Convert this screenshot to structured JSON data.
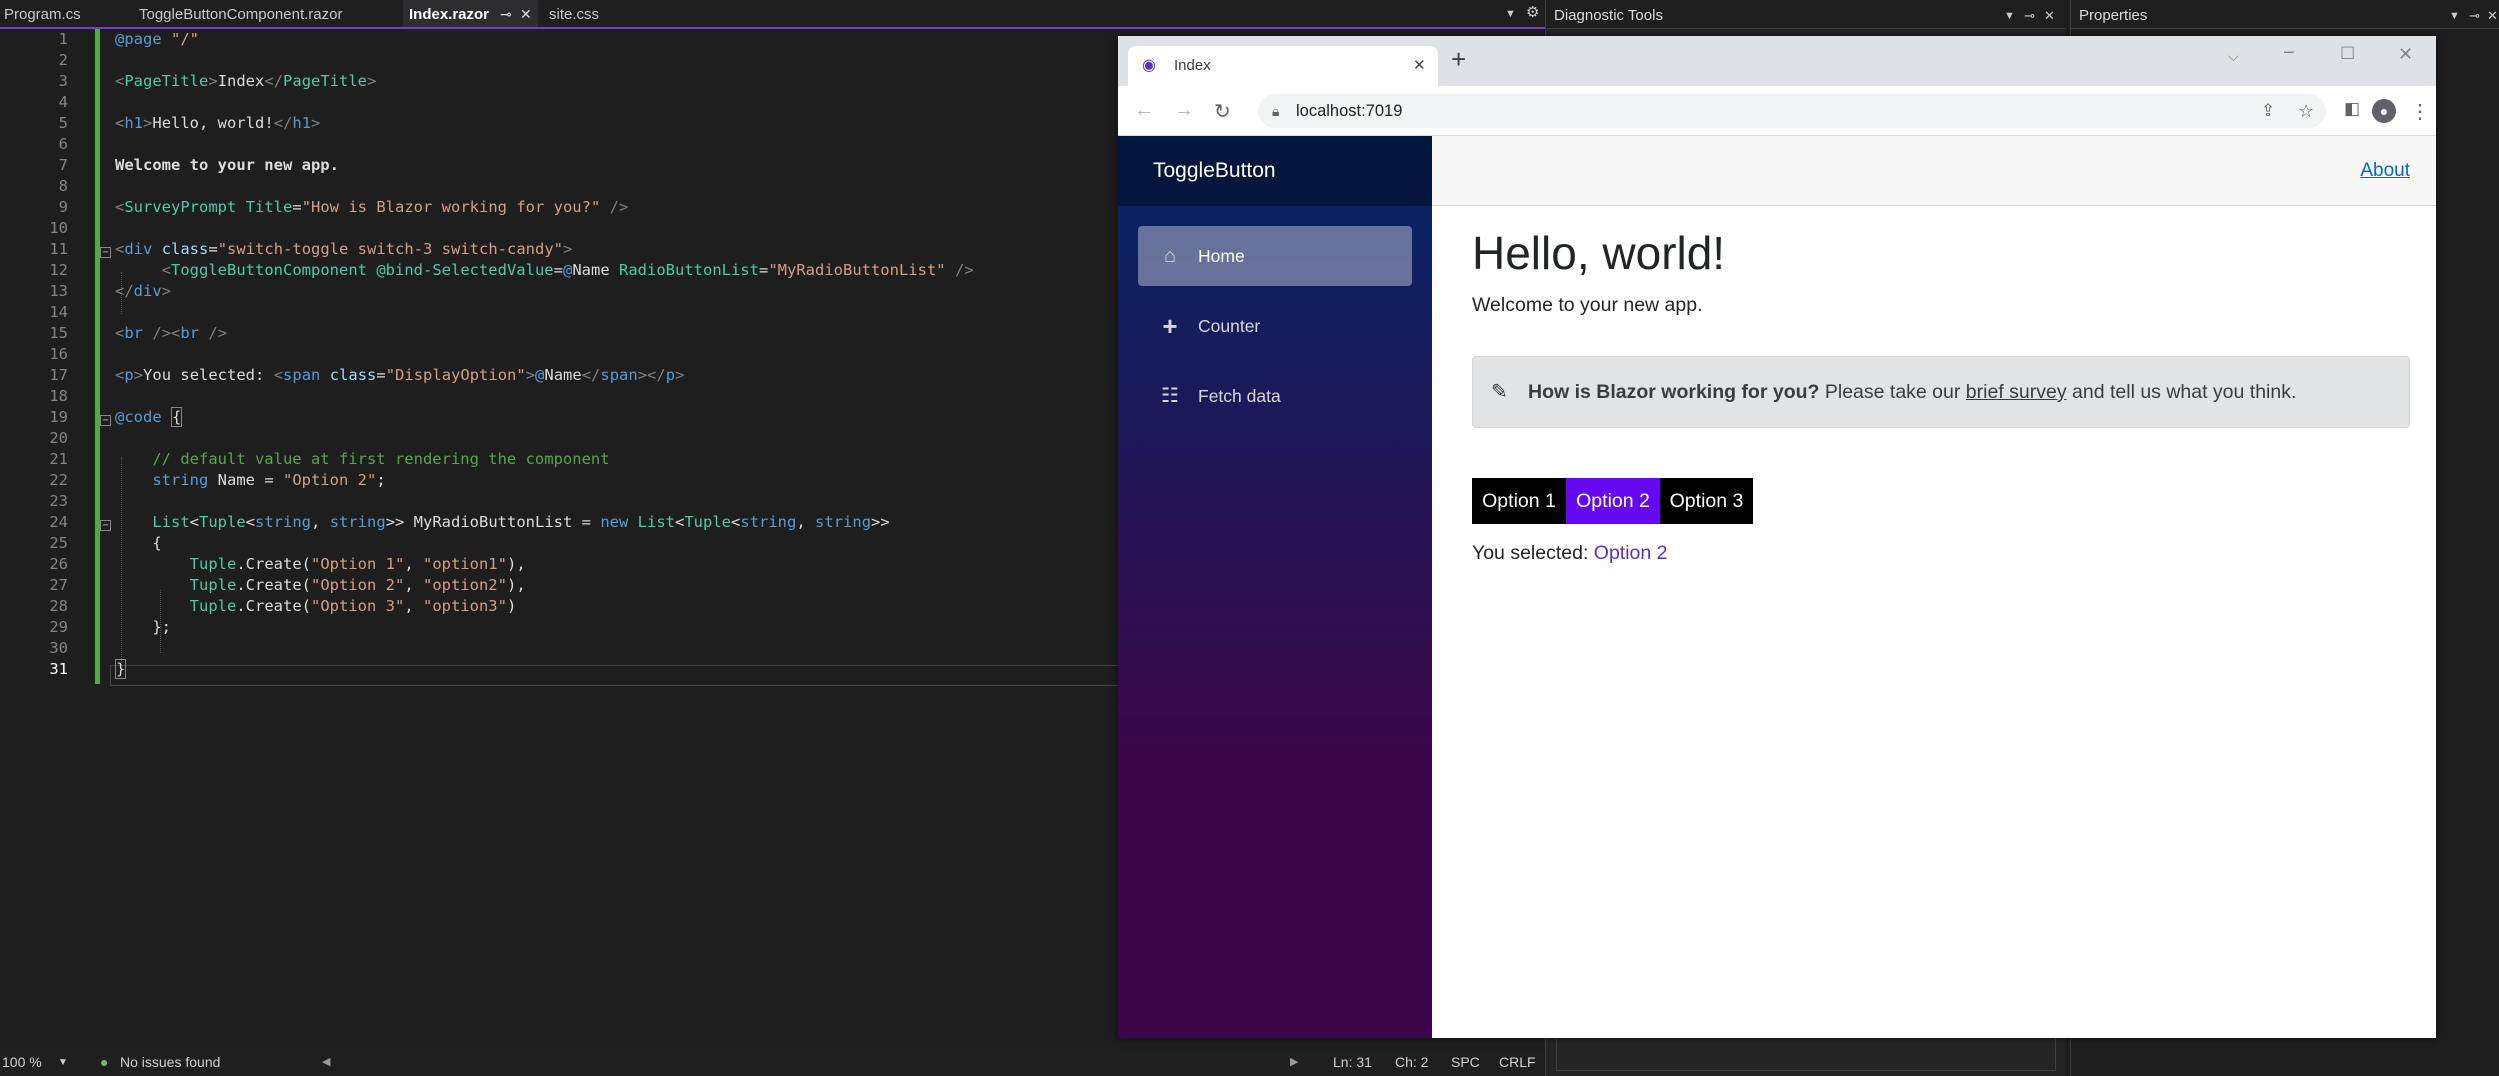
{
  "vs": {
    "tabs": [
      {
        "label": "Program.cs",
        "active": false
      },
      {
        "label": "ToggleButtonComponent.razor",
        "active": false
      },
      {
        "label": "Index.razor",
        "active": true
      },
      {
        "label": "site.css",
        "active": false
      }
    ],
    "editor": {
      "line_numbers": [
        "1",
        "2",
        "3",
        "4",
        "5",
        "6",
        "7",
        "8",
        "9",
        "10",
        "11",
        "12",
        "13",
        "14",
        "15",
        "16",
        "17",
        "18",
        "19",
        "20",
        "21",
        "22",
        "23",
        "24",
        "25",
        "26",
        "27",
        "28",
        "29",
        "30",
        "31"
      ],
      "current_line": "31"
    },
    "status": {
      "zoom": "100 %",
      "issues": "No issues found",
      "ln": "Ln: 31",
      "ch": "Ch: 2",
      "spc": "SPC",
      "crlf": "CRLF"
    },
    "diagnostic_title": "Diagnostic Tools",
    "properties_title": "Properties"
  },
  "browser": {
    "tab_title": "Index",
    "url": "localhost:7019",
    "app": {
      "brand": "ToggleButton",
      "nav": [
        {
          "label": "Home",
          "icon": "home-icon",
          "active": true
        },
        {
          "label": "Counter",
          "icon": "plus-icon",
          "active": false
        },
        {
          "label": "Fetch data",
          "icon": "list-icon",
          "active": false
        }
      ],
      "about": "About",
      "heading": "Hello, world!",
      "welcome": "Welcome to your new app.",
      "survey": {
        "question": "How is Blazor working for you?",
        "prefix": "Please take our",
        "link": "brief survey",
        "suffix": "and tell us what you think."
      },
      "toggle_options": [
        "Option 1",
        "Option 2",
        "Option 3"
      ],
      "selected_index": 1,
      "you_selected_label": "You selected:",
      "selected_value": "Option 2"
    }
  },
  "colors": {
    "toggle_selected": "#6609f2",
    "toggle_default": "#000000",
    "accent_purple": "#6e3fd0",
    "link_blue": "#0366d6"
  }
}
